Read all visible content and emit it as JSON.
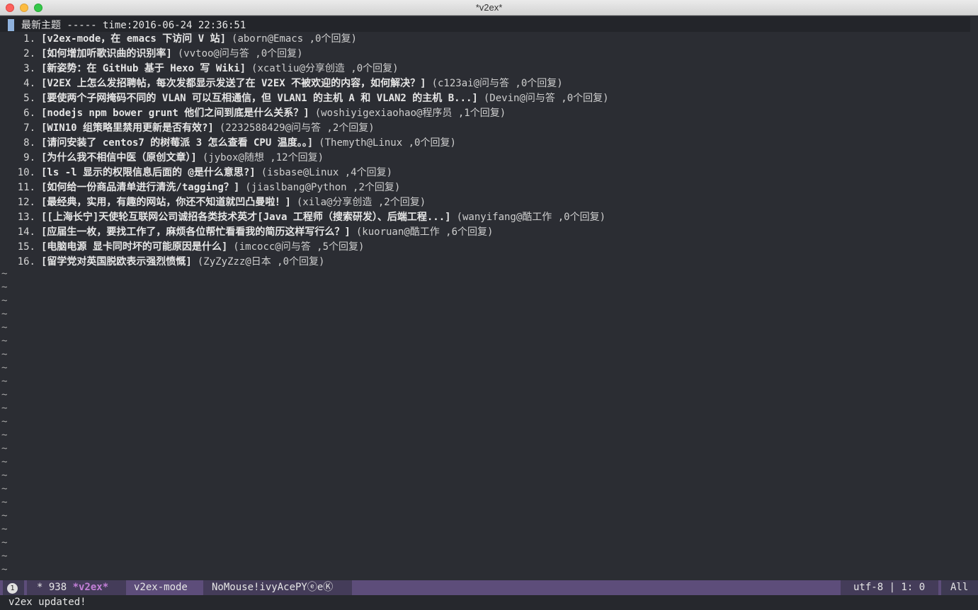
{
  "window": {
    "title": "*v2ex*"
  },
  "header": {
    "text": "最新主题 ----- time:2016-06-24 22:36:51"
  },
  "topics": [
    {
      "num": "1.",
      "title": "[v2ex-mode，在 emacs 下访问 V 站]",
      "meta": "(aborn@Emacs ,0个回复)"
    },
    {
      "num": "2.",
      "title": "[如何增加听歌识曲的识别率]",
      "meta": "(vvtoo@问与答 ,0个回复)"
    },
    {
      "num": "3.",
      "title": "[新姿势：在 GitHub 基于 Hexo 写 Wiki]",
      "meta": "(xcatliu@分享创造 ,0个回复)"
    },
    {
      "num": "4.",
      "title": "[V2EX 上怎么发招聘帖，每次发都显示发送了在 V2EX 不被欢迎的内容，如何解决？]",
      "meta": "(c123ai@问与答 ,0个回复)"
    },
    {
      "num": "5.",
      "title": "[要使两个子网掩码不同的 VLAN 可以互相通信，但 VLAN1 的主机 A 和 VLAN2 的主机 B...]",
      "meta": "(Devin@问与答 ,0个回复)"
    },
    {
      "num": "6.",
      "title": "[nodejs npm bower grunt 他们之间到底是什么关系？]",
      "meta": "(woshiyigexiaohao@程序员 ,1个回复)"
    },
    {
      "num": "7.",
      "title": "[WIN10 组策略里禁用更新是否有效?]",
      "meta": "(2232588429@问与答 ,2个回复)"
    },
    {
      "num": "8.",
      "title": "[请问安装了 centos7 的树莓派 3 怎么查看 CPU 温度。。]",
      "meta": "(Themyth@Linux ,0个回复)"
    },
    {
      "num": "9.",
      "title": "[为什么我不相信中医（原创文章）]",
      "meta": "(jybox@随想 ,12个回复)"
    },
    {
      "num": "10.",
      "title": "[ls -l 显示的权限信息后面的 @是什么意思?]",
      "meta": "(isbase@Linux ,4个回复)"
    },
    {
      "num": "11.",
      "title": "[如何给一份商品清单进行清洗/tagging？]",
      "meta": "(jiaslbang@Python ,2个回复)"
    },
    {
      "num": "12.",
      "title": "[最经典，实用，有趣的网站，你还不知道就凹凸曼啦！]",
      "meta": "(xila@分享创造 ,2个回复)"
    },
    {
      "num": "13.",
      "title": "[[上海长宁]天使轮互联网公司诚招各类技术英才[Java 工程师（搜索研发）、后端工程...]",
      "meta": "(wanyifang@酷工作 ,0个回复)"
    },
    {
      "num": "14.",
      "title": "[应届生一枚，要找工作了，麻烦各位帮忙看看我的简历这样写行么？]",
      "meta": "(kuoruan@酷工作 ,6个回复)"
    },
    {
      "num": "15.",
      "title": "[电脑电源 显卡同时坏的可能原因是什么]",
      "meta": "(imcocc@问与答 ,5个回复)"
    },
    {
      "num": "16.",
      "title": "[留学党对英国脱欧表示强烈愤慨]",
      "meta": "(ZyZyZzz@日本 ,0个回复)"
    }
  ],
  "tilde": "~",
  "modeline": {
    "window_number": "1",
    "buffer_prefix": "* 938 ",
    "buffer_name": "*v2ex*",
    "major_mode": "v2ex-mode",
    "minor_modes": "NoMouse!ivyAcePYⓔeⓀ",
    "encoding": "utf-8 | 1: 0",
    "position": "All"
  },
  "echo_area": {
    "message": "v2ex updated!"
  },
  "colors": {
    "background": "#2b2d33",
    "modeline": "#5d4d7a",
    "buffer_name": "#c27fd7",
    "cursor": "#8fb2dd"
  }
}
